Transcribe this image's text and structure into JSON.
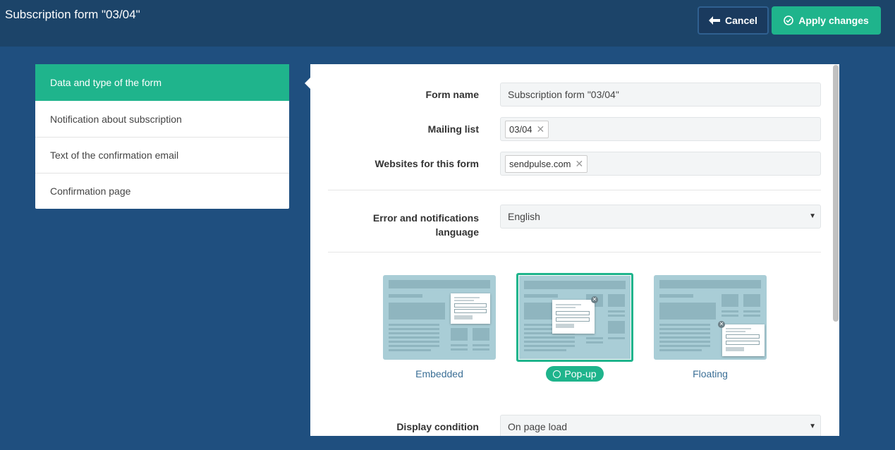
{
  "header": {
    "title": "Subscription form \"03/04\"",
    "cancel_label": "Cancel",
    "apply_label": "Apply changes"
  },
  "sidebar": {
    "items": [
      {
        "label": "Data and type of the form"
      },
      {
        "label": "Notification about subscription"
      },
      {
        "label": "Text of the confirmation email"
      },
      {
        "label": "Confirmation page"
      }
    ]
  },
  "form": {
    "form_name_label": "Form name",
    "form_name_value": "Subscription form \"03/04\"",
    "mailing_list_label": "Mailing list",
    "mailing_list_tag": "03/04",
    "websites_label": "Websites for this form",
    "websites_tag": "sendpulse.com",
    "language_label_line1": "Error and notifications",
    "language_label_line2": "language",
    "language_value": "English",
    "display_condition_label": "Display condition",
    "display_condition_value": "On page load"
  },
  "form_types": {
    "embedded": "Embedded",
    "popup": "Pop-up",
    "floating": "Floating",
    "selected": "Pop-up"
  },
  "colors": {
    "accent": "#1fb48c",
    "background": "#1f4f7f",
    "topbar": "#1c4469"
  }
}
